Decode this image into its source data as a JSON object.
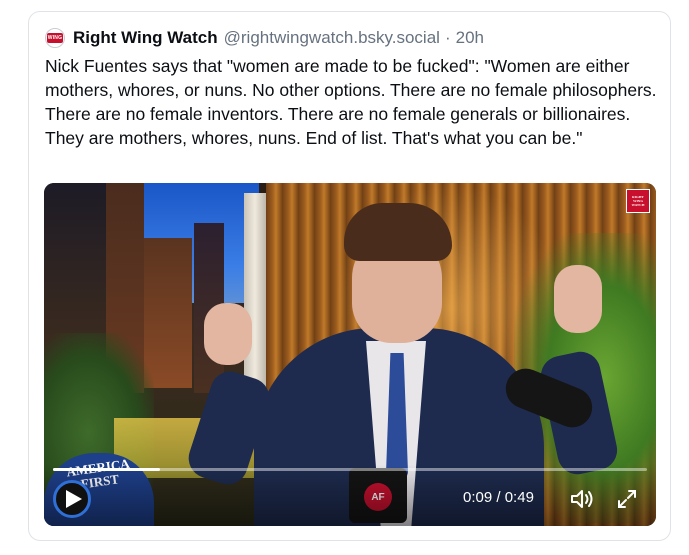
{
  "post": {
    "author_name": "Right Wing Watch",
    "handle": "@rightwingwatch.bsky.social",
    "separator": "·",
    "time": "20h",
    "avatar_text": "WING",
    "text": "Nick Fuentes says that \"women are made to be fucked\": \"Women are either mothers, whores, or nuns. No other options. There are no female philosophers. There are no female inventors. There are no female generals or billionaires. They are mothers, whores, nuns. End of list. That's what you can be.\""
  },
  "video": {
    "watermark_text": "RIGHT WING WATCH",
    "hat_text": "AMERICA FIRST",
    "mug_text": "AF",
    "current_time": "0:09",
    "duration": "0:49",
    "time_separator": " / ",
    "progress_fraction": 0.18
  },
  "icons": {
    "play": "play-icon",
    "volume": "volume-icon",
    "fullscreen": "fullscreen-icon"
  },
  "colors": {
    "play_ring": "#2f6fd6",
    "watermark_bg": "#c8102e"
  }
}
